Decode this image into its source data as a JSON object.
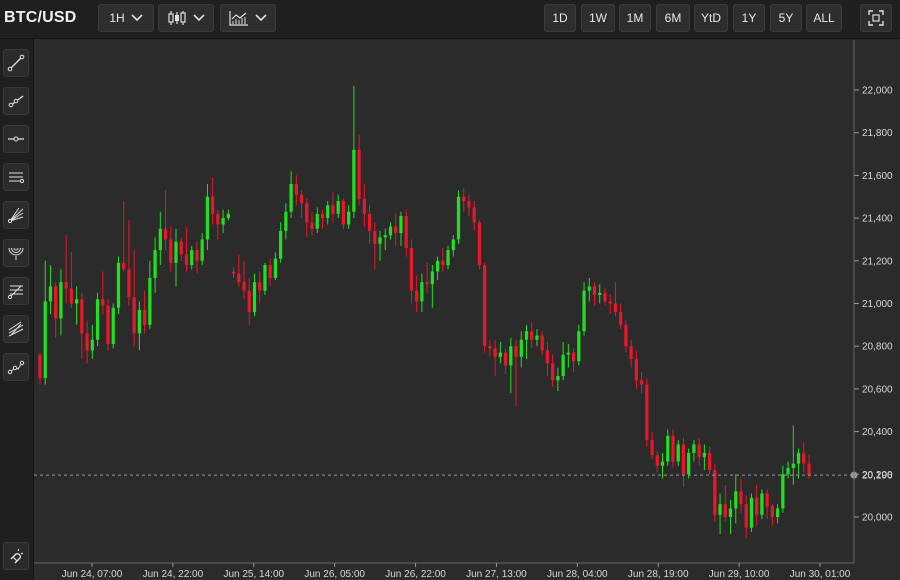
{
  "toolbar": {
    "symbol": "BTC/USD",
    "interval_label": "1H",
    "chart_type_icon": "candlestick-icon",
    "indicators_icon": "indicators-chart-icon",
    "ranges": [
      "1D",
      "1W",
      "1M",
      "6M",
      "YtD",
      "1Y",
      "5Y",
      "ALL"
    ],
    "fullscreen_icon": "fullscreen-icon"
  },
  "sidebar": {
    "tools": [
      "trend-line-icon",
      "ray-icon",
      "horizontal-line-icon",
      "parallel-channel-icon",
      "fib-fan-icon",
      "fib-arc-icon",
      "fib-retracement-icon",
      "pitchfork-icon",
      "path-icon"
    ],
    "bottom_tool": "magnet-icon"
  },
  "colors": {
    "up": "#21e021",
    "down": "#e8172b",
    "background": "#2b2b2b",
    "price_line": "#9a9a9a"
  },
  "chart_data": {
    "type": "candlestick",
    "title": "BTC/USD",
    "interval": "1H",
    "ylim": [
      19780,
      22200
    ],
    "yticks": [
      20000,
      20200,
      20400,
      20600,
      20800,
      21000,
      21200,
      21400,
      21600,
      21800,
      22000
    ],
    "ytick_labels": [
      "20,000",
      "20,200",
      "20,400",
      "20,600",
      "20,800",
      "21,000",
      "21,200",
      "21,400",
      "21,600",
      "21,800",
      "22,000"
    ],
    "xtick_labels": [
      "Jun 24, 07:00",
      "Jun 24, 22:00",
      "Jun 25, 14:00",
      "Jun 26, 05:00",
      "Jun 26, 22:00",
      "Jun 27, 13:00",
      "Jun 28, 04:00",
      "Jun 28, 19:00",
      "Jun 29, 10:00",
      "Jun 30, 01:00"
    ],
    "last_price_label": "20,196",
    "last_price": 20196,
    "grid": false,
    "candles": [
      [
        20760,
        20770,
        20620,
        20650
      ],
      [
        20650,
        21200,
        20620,
        21010
      ],
      [
        21010,
        21180,
        20950,
        21080
      ],
      [
        21080,
        21100,
        20840,
        20930
      ],
      [
        20930,
        21160,
        20850,
        21100
      ],
      [
        21100,
        21320,
        21000,
        21070
      ],
      [
        21070,
        21240,
        20980,
        21000
      ],
      [
        21000,
        21080,
        20900,
        21020
      ],
      [
        21020,
        21050,
        20740,
        20860
      ],
      [
        20860,
        20920,
        20720,
        20780
      ],
      [
        20780,
        20900,
        20740,
        20830
      ],
      [
        20830,
        21050,
        20800,
        21020
      ],
      [
        21020,
        21150,
        20950,
        20990
      ],
      [
        20990,
        21020,
        20780,
        20810
      ],
      [
        20810,
        21000,
        20790,
        20980
      ],
      [
        20980,
        21220,
        20950,
        21190
      ],
      [
        21190,
        21480,
        21150,
        21160
      ],
      [
        21160,
        21390,
        20990,
        21030
      ],
      [
        21030,
        21250,
        20800,
        20860
      ],
      [
        20860,
        21010,
        20780,
        20970
      ],
      [
        20970,
        21060,
        20860,
        20900
      ],
      [
        20900,
        21200,
        20880,
        21120
      ],
      [
        21120,
        21310,
        21050,
        21250
      ],
      [
        21250,
        21430,
        21180,
        21350
      ],
      [
        21350,
        21530,
        21250,
        21300
      ],
      [
        21300,
        21360,
        21150,
        21190
      ],
      [
        21190,
        21350,
        21080,
        21290
      ],
      [
        21290,
        21310,
        21200,
        21230
      ],
      [
        21230,
        21360,
        21150,
        21180
      ],
      [
        21180,
        21270,
        21160,
        21250
      ],
      [
        21250,
        21290,
        21140,
        21200
      ],
      [
        21200,
        21330,
        21180,
        21300
      ],
      [
        21300,
        21560,
        21250,
        21500
      ],
      [
        21500,
        21590,
        21370,
        21420
      ],
      [
        21420,
        21440,
        21300,
        21370
      ],
      [
        21370,
        21440,
        21330,
        21400
      ],
      [
        21400,
        21440,
        21390,
        21420
      ],
      [
        21150,
        21170,
        21120,
        21140
      ],
      [
        21140,
        21230,
        21080,
        21100
      ],
      [
        21100,
        21200,
        21020,
        21060
      ],
      [
        21060,
        21120,
        20900,
        20960
      ],
      [
        20960,
        21140,
        20940,
        21100
      ],
      [
        21100,
        21150,
        21000,
        21060
      ],
      [
        21060,
        21190,
        21040,
        21180
      ],
      [
        21180,
        21210,
        21080,
        21120
      ],
      [
        21120,
        21240,
        21110,
        21210
      ],
      [
        21210,
        21380,
        21190,
        21340
      ],
      [
        21340,
        21470,
        21300,
        21430
      ],
      [
        21430,
        21620,
        21400,
        21560
      ],
      [
        21560,
        21600,
        21460,
        21510
      ],
      [
        21510,
        21530,
        21400,
        21470
      ],
      [
        21470,
        21490,
        21310,
        21380
      ],
      [
        21380,
        21430,
        21320,
        21350
      ],
      [
        21350,
        21450,
        21330,
        21420
      ],
      [
        21420,
        21440,
        21350,
        21400
      ],
      [
        21400,
        21480,
        21370,
        21460
      ],
      [
        21460,
        21520,
        21380,
        21420
      ],
      [
        21420,
        21510,
        21400,
        21480
      ],
      [
        21480,
        21490,
        21350,
        21370
      ],
      [
        21370,
        21460,
        21350,
        21430
      ],
      [
        21430,
        22020,
        21400,
        21720
      ],
      [
        21720,
        21790,
        21460,
        21490
      ],
      [
        21490,
        21560,
        21360,
        21420
      ],
      [
        21420,
        21460,
        21280,
        21340
      ],
      [
        21340,
        21380,
        21160,
        21280
      ],
      [
        21280,
        21340,
        21200,
        21310
      ],
      [
        21310,
        21350,
        21250,
        21320
      ],
      [
        21320,
        21380,
        21300,
        21360
      ],
      [
        21360,
        21420,
        21270,
        21330
      ],
      [
        21330,
        21430,
        21270,
        21410
      ],
      [
        21410,
        21440,
        21220,
        21260
      ],
      [
        21260,
        21300,
        21000,
        21060
      ],
      [
        21060,
        21130,
        20960,
        21010
      ],
      [
        21010,
        21140,
        20960,
        21100
      ],
      [
        21100,
        21190,
        21050,
        21090
      ],
      [
        21090,
        21180,
        20980,
        21150
      ],
      [
        21150,
        21220,
        21110,
        21200
      ],
      [
        21200,
        21260,
        21150,
        21180
      ],
      [
        21180,
        21270,
        21160,
        21250
      ],
      [
        21250,
        21320,
        21220,
        21300
      ],
      [
        21300,
        21530,
        21280,
        21500
      ],
      [
        21500,
        21540,
        21430,
        21480
      ],
      [
        21480,
        21510,
        21410,
        21450
      ],
      [
        21450,
        21480,
        21340,
        21380
      ],
      [
        21380,
        21390,
        21160,
        21180
      ],
      [
        21180,
        21190,
        20770,
        20800
      ],
      [
        20800,
        20830,
        20750,
        20790
      ],
      [
        20790,
        20830,
        20660,
        20750
      ],
      [
        20750,
        20820,
        20720,
        20770
      ],
      [
        20770,
        20790,
        20670,
        20710
      ],
      [
        20710,
        20840,
        20580,
        20800
      ],
      [
        20800,
        20830,
        20520,
        20750
      ],
      [
        20750,
        20870,
        20700,
        20830
      ],
      [
        20830,
        20900,
        20740,
        20870
      ],
      [
        20870,
        20910,
        20790,
        20830
      ],
      [
        20830,
        20880,
        20800,
        20850
      ],
      [
        20850,
        20870,
        20760,
        20780
      ],
      [
        20780,
        20820,
        20660,
        20720
      ],
      [
        20720,
        20760,
        20610,
        20640
      ],
      [
        20640,
        20700,
        20590,
        20660
      ],
      [
        20660,
        20820,
        20640,
        20760
      ],
      [
        20760,
        20810,
        20700,
        20770
      ],
      [
        20770,
        20790,
        20680,
        20730
      ],
      [
        20730,
        20900,
        20710,
        20870
      ],
      [
        20870,
        21100,
        20850,
        21060
      ],
      [
        21060,
        21120,
        21010,
        21080
      ],
      [
        21080,
        21100,
        20990,
        21040
      ],
      [
        21040,
        21090,
        21000,
        21050
      ],
      [
        21050,
        21070,
        20990,
        21010
      ],
      [
        21010,
        21040,
        20950,
        21000
      ],
      [
        21000,
        21100,
        20940,
        20960
      ],
      [
        20960,
        21000,
        20880,
        20900
      ],
      [
        20900,
        20920,
        20770,
        20800
      ],
      [
        20800,
        20830,
        20700,
        20740
      ],
      [
        20740,
        20780,
        20600,
        20640
      ],
      [
        20640,
        20680,
        20580,
        20620
      ],
      [
        20620,
        20650,
        20330,
        20360
      ],
      [
        20360,
        20400,
        20270,
        20290
      ],
      [
        20290,
        20310,
        20210,
        20240
      ],
      [
        20240,
        20300,
        20180,
        20260
      ],
      [
        20260,
        20410,
        20240,
        20380
      ],
      [
        20380,
        20410,
        20230,
        20260
      ],
      [
        20260,
        20360,
        20240,
        20340
      ],
      [
        20340,
        20370,
        20140,
        20200
      ],
      [
        20200,
        20320,
        20180,
        20300
      ],
      [
        20300,
        20360,
        20260,
        20340
      ],
      [
        20340,
        20370,
        20240,
        20280
      ],
      [
        20280,
        20340,
        20220,
        20300
      ],
      [
        20300,
        20330,
        20200,
        20220
      ],
      [
        20220,
        20250,
        19980,
        20010
      ],
      [
        20010,
        20110,
        19920,
        20060
      ],
      [
        20060,
        20150,
        19980,
        20000
      ],
      [
        20000,
        20080,
        19920,
        20040
      ],
      [
        20040,
        20200,
        19970,
        20120
      ],
      [
        20120,
        20180,
        20020,
        20060
      ],
      [
        20060,
        20100,
        19900,
        19950
      ],
      [
        19950,
        20110,
        19930,
        20090
      ],
      [
        20090,
        20150,
        19960,
        20010
      ],
      [
        20010,
        20130,
        19990,
        20110
      ],
      [
        20110,
        20130,
        19990,
        20050
      ],
      [
        20050,
        20060,
        19960,
        20000
      ],
      [
        20000,
        20060,
        19970,
        20040
      ],
      [
        20040,
        20240,
        20020,
        20200
      ],
      [
        20200,
        20260,
        20180,
        20230
      ],
      [
        20230,
        20430,
        20150,
        20250
      ],
      [
        20250,
        20320,
        20180,
        20300
      ],
      [
        20300,
        20350,
        20210,
        20250
      ],
      [
        20250,
        20290,
        20180,
        20196
      ]
    ]
  }
}
